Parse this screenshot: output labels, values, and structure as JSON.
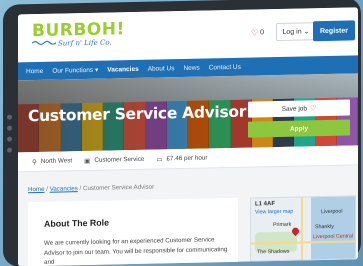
{
  "logo": {
    "title": "BURBOH!",
    "subtitle": "Surf n' Life Co."
  },
  "header": {
    "favourites_count": "0",
    "login_label": "Log in",
    "register_label": "Register"
  },
  "nav": {
    "items": [
      {
        "label": "Home"
      },
      {
        "label": "Our Functions"
      },
      {
        "label": "Vacancies",
        "active": true
      },
      {
        "label": "About Us"
      },
      {
        "label": "News"
      },
      {
        "label": "Contact Us"
      }
    ]
  },
  "hero": {
    "title": "Customer Service Advisor",
    "save_label": "Save job",
    "apply_label": "Apply"
  },
  "meta": {
    "location": "North West",
    "category": "Customer Service",
    "salary": "£7.46 per hour"
  },
  "breadcrumb": {
    "home": "Home",
    "vacancies": "Vacancies",
    "current": "Customer Service Advisor"
  },
  "about": {
    "title": "About The Role",
    "text": "We are currently looking for an experienced Customer Service Advisor to join our team. You will be responsible for communicating and"
  },
  "map": {
    "postcode": "L1 4AF",
    "link": "View larger map",
    "label_liverpool": "Liverpool",
    "label_primark": "Primark",
    "label_shankly": "Shankly",
    "label_crossroads": "Liverpool Central",
    "label_shadows": "The Shadows"
  },
  "colors": {
    "brand_blue": "#1f6fb5",
    "apply_green": "#8dc63f",
    "logo_green": "#9acd32",
    "heart_red": "#d0202a"
  }
}
